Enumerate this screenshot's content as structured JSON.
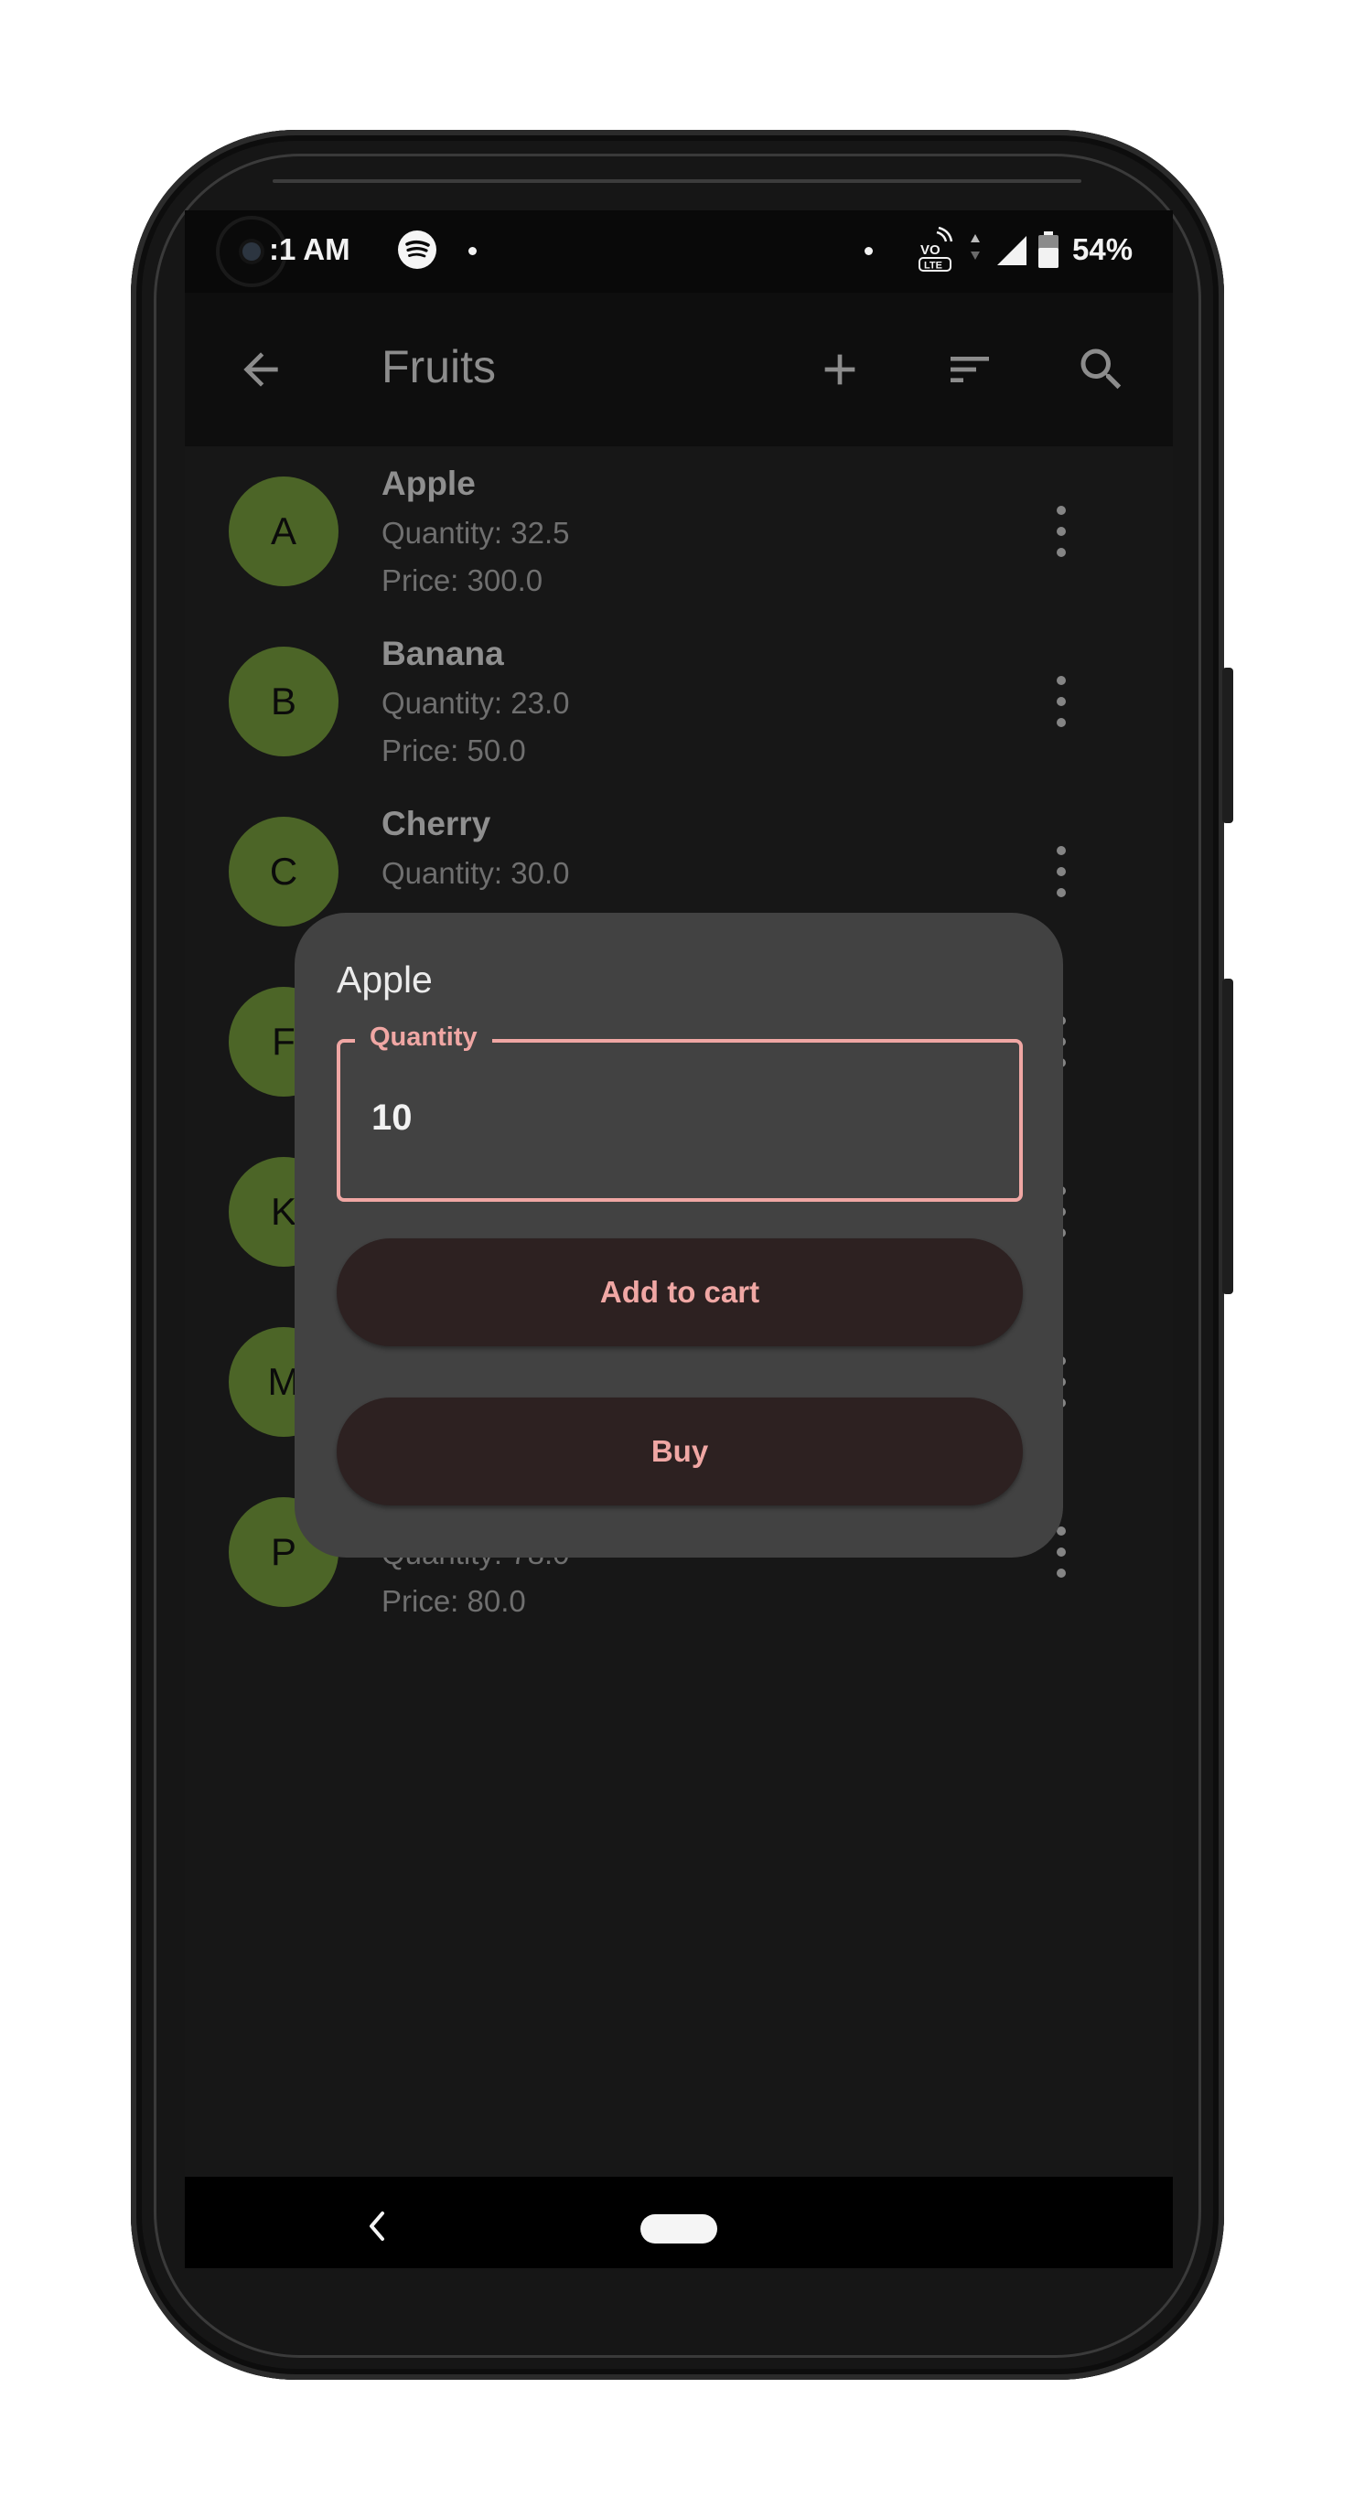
{
  "status_bar": {
    "time": ":1 AM",
    "battery_percent": "54%",
    "network_badge_line1": "VO",
    "network_badge_line2": "LTE"
  },
  "app_bar": {
    "title": "Fruits",
    "icons": [
      "arrow-back-icon",
      "add-icon",
      "sort-icon",
      "search-icon"
    ]
  },
  "fruits": [
    {
      "initial": "A",
      "name": "Apple",
      "quantity": "Quantity: 32.5",
      "price": "Price: 300.0"
    },
    {
      "initial": "B",
      "name": "Banana",
      "quantity": "Quantity: 23.0",
      "price": "Price: 50.0"
    },
    {
      "initial": "C",
      "name": "Cherry",
      "quantity": "Quantity: 30.0"
    },
    {
      "initial": "F"
    },
    {
      "initial": "K"
    },
    {
      "initial": "M"
    },
    {
      "initial": "P",
      "quantity": "Quantity: 78.0",
      "price": "Price: 80.0"
    }
  ],
  "dialog": {
    "title": "Apple",
    "quantity_label": "Quantity",
    "quantity_value": "10",
    "add_to_cart_label": "Add to cart",
    "buy_label": "Buy"
  },
  "colors": {
    "avatar": "#4c6527",
    "accent": "#f0a7a4",
    "dialog_bg": "#424242",
    "button_bg": "#2d2121"
  }
}
